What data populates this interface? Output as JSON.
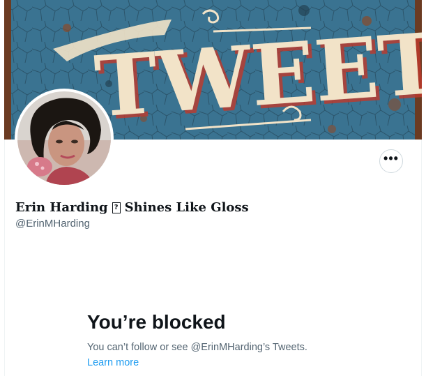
{
  "banner": {
    "text": "TWEET"
  },
  "profile": {
    "name_script": "Erin Harding",
    "name_glyph": "?",
    "name_tagline": "Shines Like Gloss",
    "handle": "@ErinMHarding"
  },
  "actions": {
    "more_label": "•••"
  },
  "blocked": {
    "title": "You’re blocked",
    "description": "You can’t follow or see @ErinMHarding’s Tweets.",
    "link": "Learn more"
  },
  "colors": {
    "banner_blue": "#3a7391",
    "text_primary": "#0f1419",
    "text_secondary": "#536471",
    "link": "#1d9bf0"
  }
}
